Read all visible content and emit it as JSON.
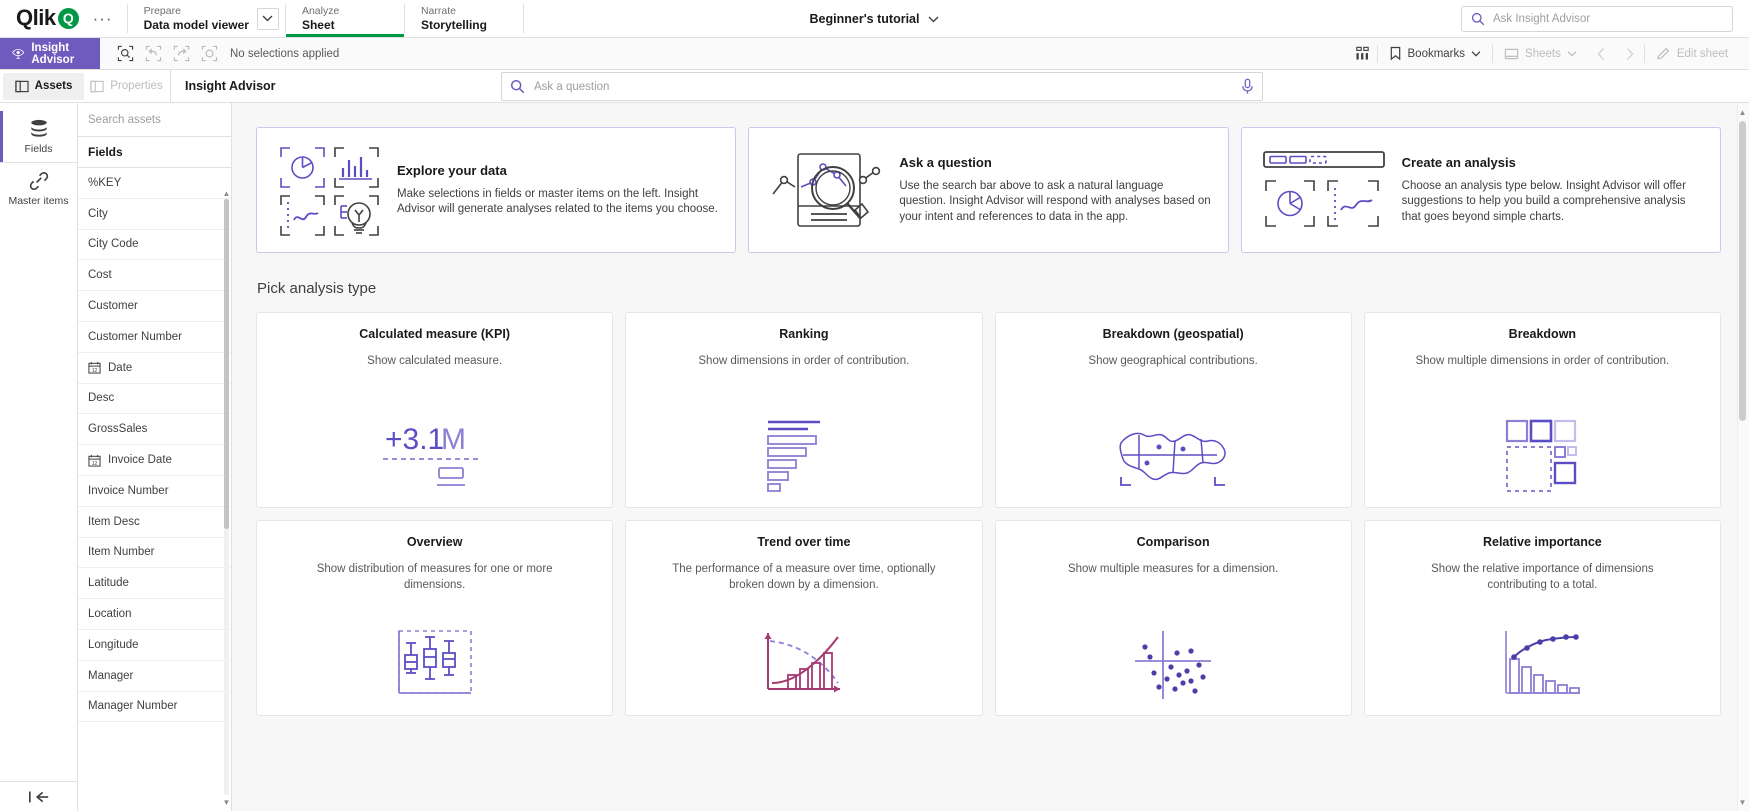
{
  "topbar": {
    "logo_text": "Qlik",
    "logo_mark": "Q",
    "more_label": "···",
    "hub_items": [
      {
        "kicker": "Prepare",
        "label": "Data model viewer",
        "has_caret": true,
        "active": false
      },
      {
        "kicker": "Analyze",
        "label": "Sheet",
        "has_caret": false,
        "active": true
      },
      {
        "kicker": "Narrate",
        "label": "Storytelling",
        "has_caret": false,
        "active": false
      }
    ],
    "app_title": "Beginner's tutorial",
    "ask_insight_advisor_placeholder": "Ask Insight Advisor"
  },
  "selection_bar": {
    "insight_advisor_label": "Insight Advisor",
    "tools": [
      {
        "name": "selection-search-icon",
        "disabled": false
      },
      {
        "name": "undo-icon",
        "disabled": true
      },
      {
        "name": "redo-icon",
        "disabled": true
      },
      {
        "name": "clear-selections-icon",
        "disabled": true
      }
    ],
    "status_text": "No selections applied",
    "grid_view_label": "",
    "bookmarks_label": "Bookmarks",
    "sheets_label": "Sheets",
    "edit_sheet_label": "Edit sheet"
  },
  "panel_tabs": [
    {
      "label": "Assets",
      "active": true,
      "disabled": false
    },
    {
      "label": "Properties",
      "active": false,
      "disabled": true
    }
  ],
  "insight_advisor": {
    "header_title": "Insight Advisor",
    "ask_placeholder": "Ask a question"
  },
  "left_rail": [
    {
      "label": "Fields",
      "icon": "database-icon",
      "active": true
    },
    {
      "label": "Master items",
      "icon": "link-icon",
      "active": false
    }
  ],
  "assets": {
    "search_placeholder": "Search assets",
    "section_label": "Fields",
    "fields": [
      {
        "name": "%KEY",
        "icon": null
      },
      {
        "name": "City",
        "icon": null
      },
      {
        "name": "City Code",
        "icon": null
      },
      {
        "name": "Cost",
        "icon": null
      },
      {
        "name": "Customer",
        "icon": null
      },
      {
        "name": "Customer Number",
        "icon": null
      },
      {
        "name": "Date",
        "icon": "calendar-icon"
      },
      {
        "name": "Desc",
        "icon": null
      },
      {
        "name": "GrossSales",
        "icon": null
      },
      {
        "name": "Invoice Date",
        "icon": "calendar-icon"
      },
      {
        "name": "Invoice Number",
        "icon": null
      },
      {
        "name": "Item Desc",
        "icon": null
      },
      {
        "name": "Item Number",
        "icon": null
      },
      {
        "name": "Latitude",
        "icon": null
      },
      {
        "name": "Location",
        "icon": null
      },
      {
        "name": "Longitude",
        "icon": null
      },
      {
        "name": "Manager",
        "icon": null
      },
      {
        "name": "Manager Number",
        "icon": null
      }
    ]
  },
  "info_cards": [
    {
      "title": "Explore your data",
      "desc": "Make selections in fields or master items on the left. Insight Advisor will generate analyses related to the items you choose.",
      "icon": "explore-data-icon"
    },
    {
      "title": "Ask a question",
      "desc": "Use the search bar above to ask a natural language question. Insight Advisor will respond with analyses based on your intent and references to data in the app.",
      "icon": "ask-question-icon"
    },
    {
      "title": "Create an analysis",
      "desc": "Choose an analysis type below. Insight Advisor will offer suggestions to help you build a comprehensive analysis that goes beyond simple charts.",
      "icon": "create-analysis-icon"
    }
  ],
  "analysis_section": {
    "title": "Pick analysis type",
    "types": [
      {
        "title": "Calculated measure (KPI)",
        "desc": "Show calculated measure.",
        "icon": "kpi-icon"
      },
      {
        "title": "Ranking",
        "desc": "Show dimensions in order of contribution.",
        "icon": "ranking-icon"
      },
      {
        "title": "Breakdown (geospatial)",
        "desc": "Show geographical contributions.",
        "icon": "geospatial-icon"
      },
      {
        "title": "Breakdown",
        "desc": "Show multiple dimensions in order of contribution.",
        "icon": "breakdown-icon"
      },
      {
        "title": "Overview",
        "desc": "Show distribution of measures for one or more dimensions.",
        "icon": "overview-icon"
      },
      {
        "title": "Trend over time",
        "desc": "The performance of a measure over time, optionally broken down by a dimension.",
        "icon": "trend-icon"
      },
      {
        "title": "Comparison",
        "desc": "Show multiple measures for a dimension.",
        "icon": "comparison-icon"
      },
      {
        "title": "Relative importance",
        "desc": "Show the relative importance of dimensions contributing to a total.",
        "icon": "relative-importance-icon"
      }
    ]
  },
  "colors": {
    "accent_purple": "#6e5bbd",
    "brand_green": "#009845",
    "panel_bg": "#f7f7f7",
    "icon_purple": "#5b4ec4",
    "icon_dark": "#404040",
    "icon_magenta": "#a53a73"
  }
}
